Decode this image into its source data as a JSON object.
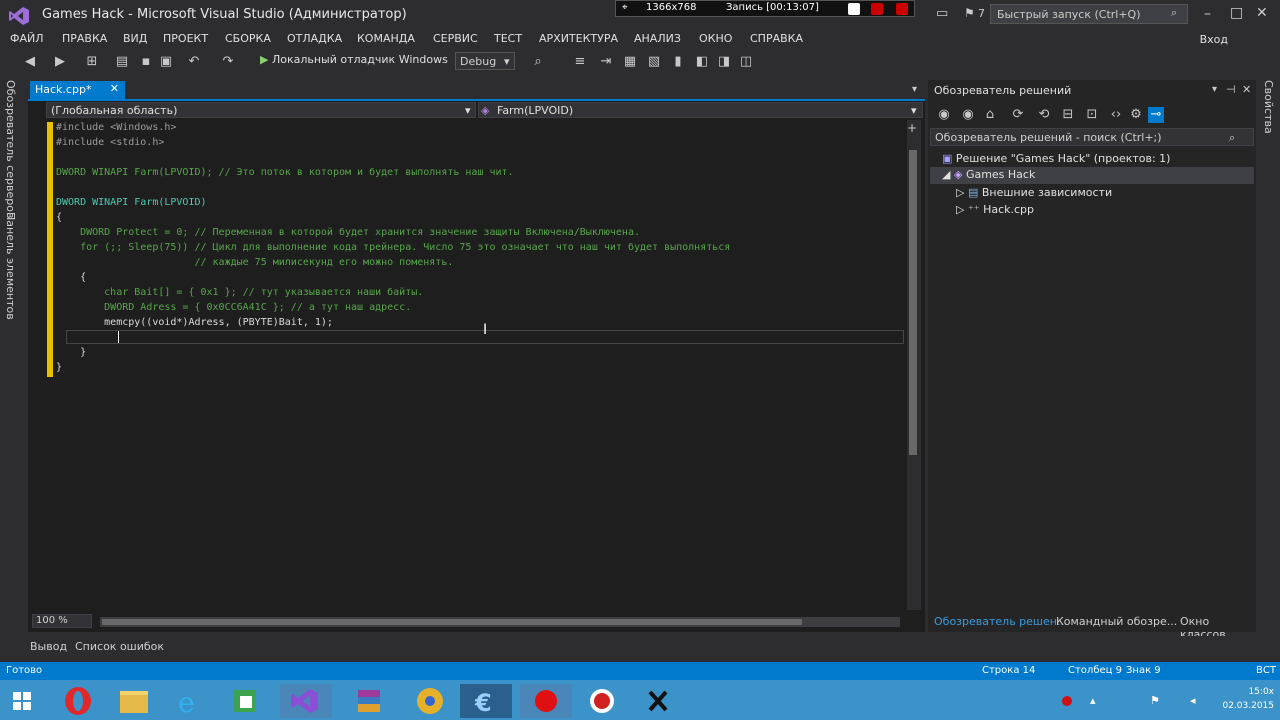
{
  "window": {
    "title": "Games Hack - Microsoft Visual Studio (Администратор)",
    "quick_launch_placeholder": "Быстрый запуск (Ctrl+Q)",
    "login": "Вход",
    "notifications_count": "7"
  },
  "recorder": {
    "counter": "1366x768",
    "label": "Запись [00:13:07]"
  },
  "menu": [
    "ФАЙЛ",
    "ПРАВКА",
    "ВИД",
    "ПРОЕКТ",
    "СБОРКА",
    "ОТЛАДКА",
    "КОМАНДА",
    "СЕРВИС",
    "ТЕСТ",
    "АРХИТЕКТУРА",
    "АНАЛИЗ",
    "ОКНО",
    "СПРАВКА"
  ],
  "toolbar": {
    "run_label": "Локальный отладчик Windows",
    "config": "Debug"
  },
  "left_tabs": [
    "Обозреватель серверов",
    "Панель элементов"
  ],
  "right_tabs": [
    "Свойства"
  ],
  "editor": {
    "tab_label": "Hack.cpp*",
    "scope": "(Глобальная область)",
    "function": "Farm(LPVOID)",
    "zoom": "100 %",
    "lines": [
      "#include <Windows.h>",
      "#include <stdio.h>",
      "",
      "DWORD WINAPI Farm(LPVOID); // Это поток в котором и будет выполнять наш чит.",
      "",
      "DWORD WINAPI Farm(LPVOID)",
      "{",
      "    DWORD Protect = 0; // Переменная в которой будет хранится значение защиты Включена/Выключена.",
      "    for (;; Sleep(75)) // Цикл для выполнение кода трейнера. Число 75 это означает что наш чит будет выполняться",
      "                       // каждые 75 милисекунд его можно поменять.",
      "    {",
      "        char Bait[] = { 0x1 }; // тут указывается наши байты.",
      "        DWORD Adress = { 0x0CC6A41C }; // а тут наш адресс.",
      "        memcpy((void*)Adress, (PBYTE)Bait, 1);",
      "",
      "    }",
      "}"
    ]
  },
  "solution_explorer": {
    "title": "Обозреватель решений",
    "search_placeholder": "Обозреватель решений - поиск (Ctrl+;)",
    "tree": [
      "Решение \"Games Hack\" (проектов: 1)",
      "Games Hack",
      "Внешние зависимости",
      "Hack.cpp"
    ],
    "tabs": [
      "Обозреватель решен...",
      "Командный обозре...",
      "Окно классов"
    ]
  },
  "bottom_tabs": [
    "Вывод",
    "Список ошибок"
  ],
  "status": {
    "ready": "Готово",
    "line": "Строка 14",
    "col": "Столбец 9",
    "char": "Знак 9",
    "mode": "ВСТ"
  },
  "clock": {
    "time": "15:0x",
    "date": "02.03.2015"
  },
  "colors": {
    "accent": "#007acc",
    "taskbar": "#3b93c9",
    "margin_marker": "#e6c200"
  }
}
